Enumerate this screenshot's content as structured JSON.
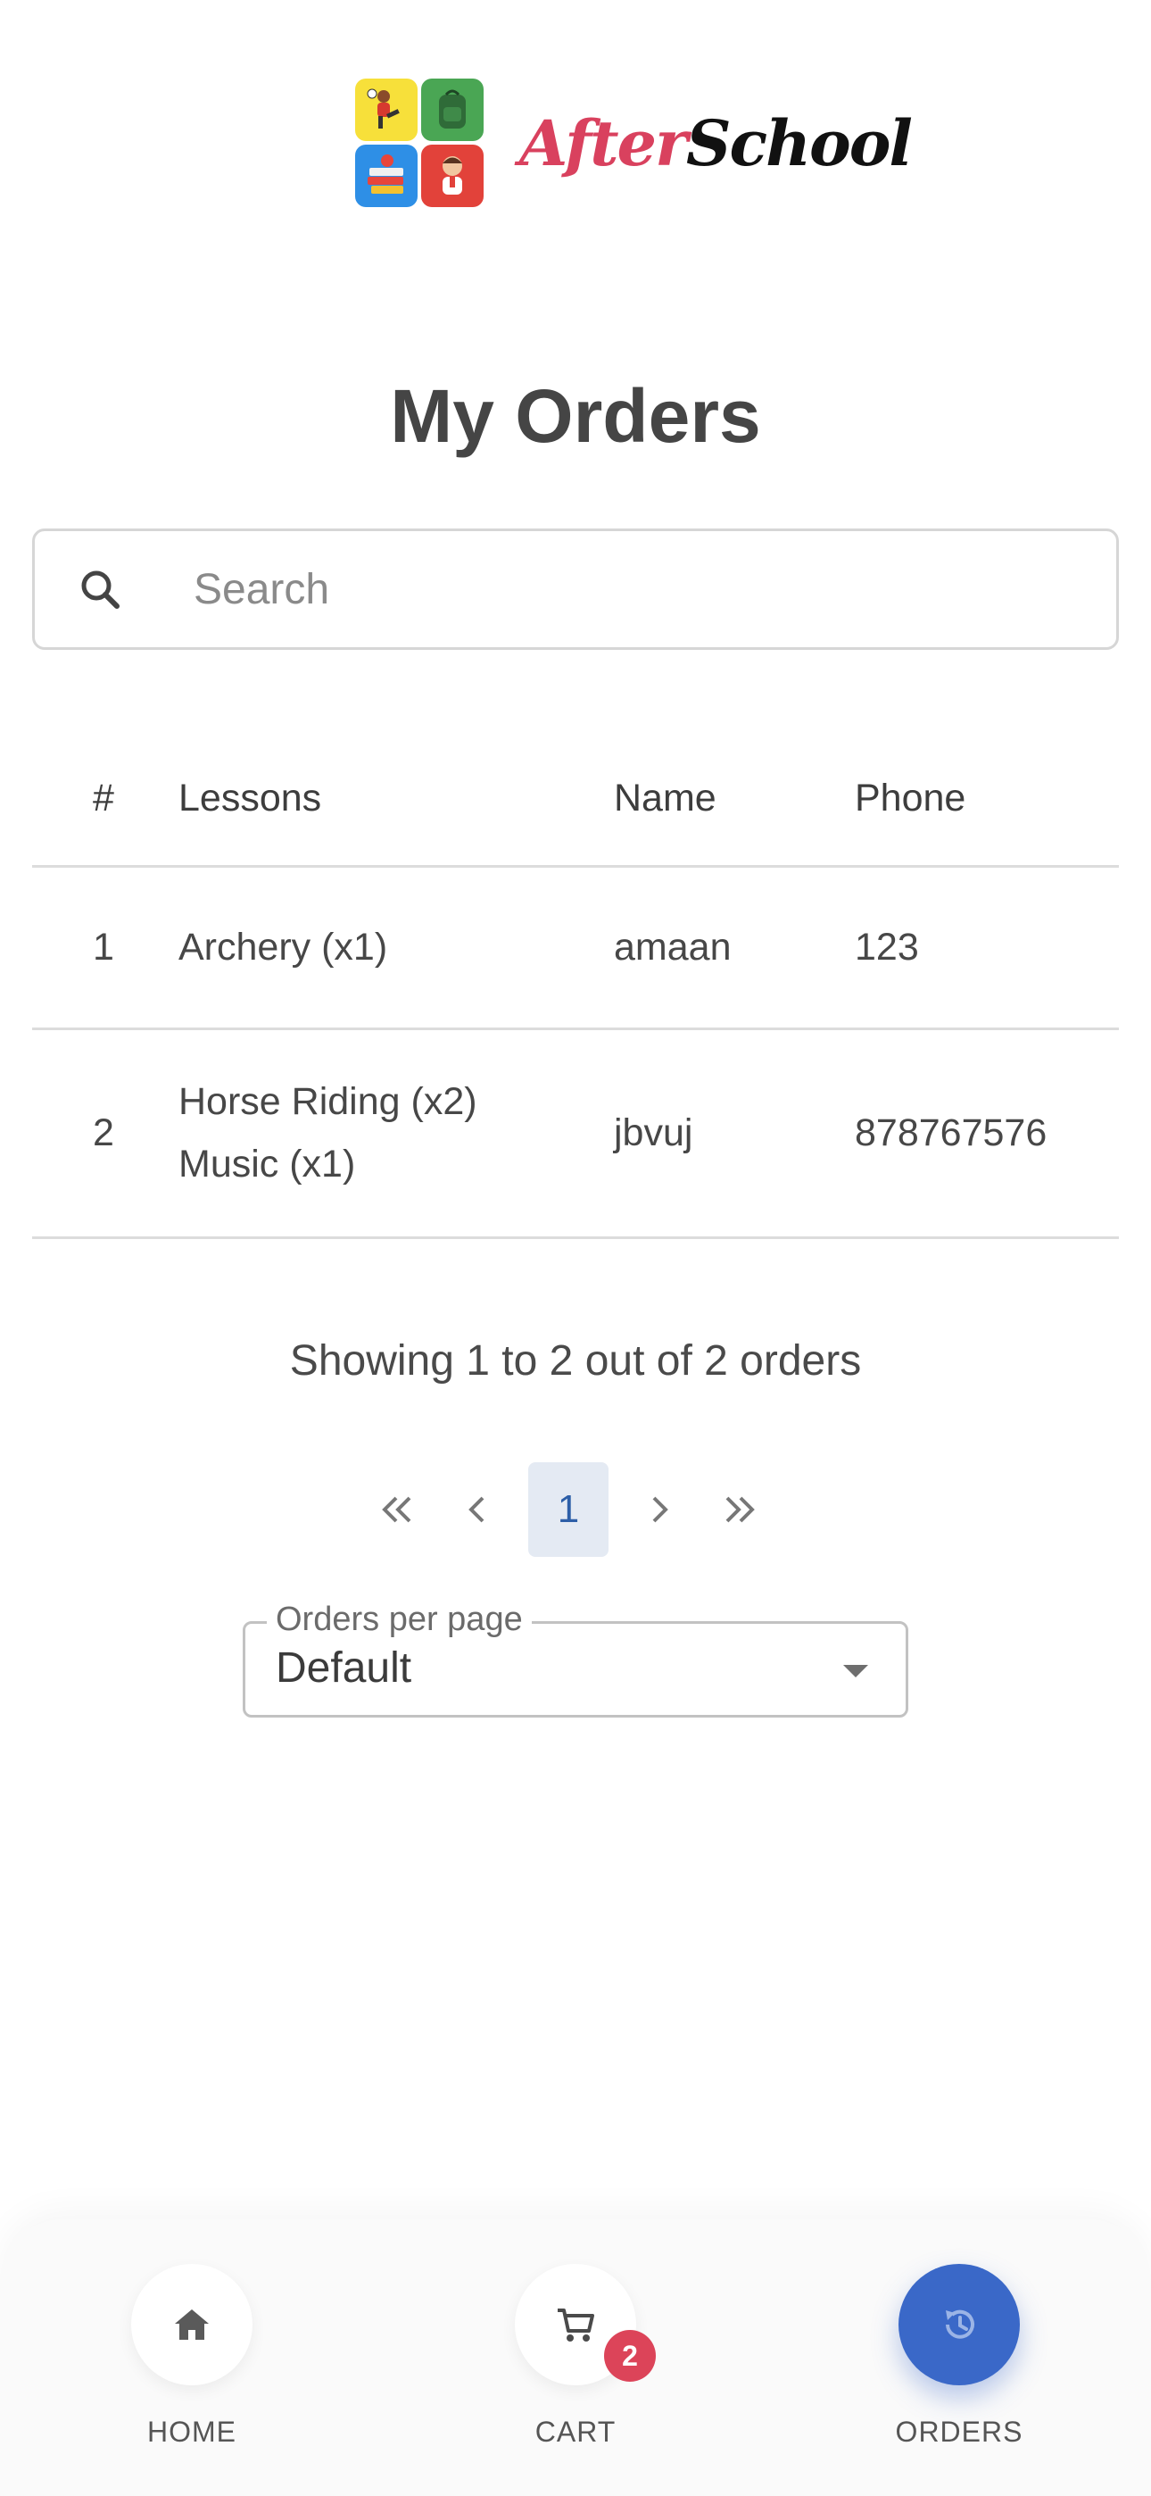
{
  "brand": {
    "after": "After",
    "school": "School"
  },
  "page": {
    "title": "My Orders"
  },
  "search": {
    "placeholder": "Search"
  },
  "table": {
    "headers": [
      "#",
      "Lessons",
      "Name",
      "Phone"
    ],
    "rows": [
      {
        "num": "1",
        "lessons": [
          "Archery (x1)"
        ],
        "name": "amaan",
        "phone": "123"
      },
      {
        "num": "2",
        "lessons": [
          "Horse Riding (x2)",
          "Music (x1)"
        ],
        "name": "jbvuj",
        "phone": "878767576"
      }
    ]
  },
  "summary": "Showing 1 to 2 out of 2 orders",
  "pagination": {
    "current": "1"
  },
  "per_page": {
    "label": "Orders per page",
    "value": "Default"
  },
  "nav": {
    "home": "HOME",
    "cart": "CART",
    "cart_badge": "2",
    "orders": "ORDERS",
    "active": "orders"
  },
  "colors": {
    "accent": "#3a68c8",
    "badge": "#dc4459",
    "brand_after": "#d9415e"
  }
}
